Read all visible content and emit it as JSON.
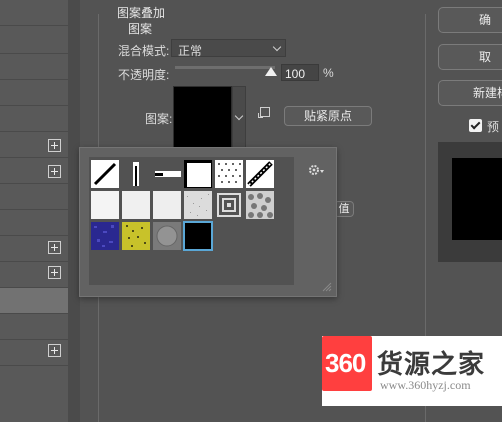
{
  "dialog": {
    "section_title": "图案叠加",
    "group_title": "图案",
    "blend_mode_label": "混合模式:",
    "blend_mode_value": "正常",
    "opacity_label": "不透明度:",
    "opacity_value": "100",
    "opacity_unit": "%",
    "opacity_slider_level": 1.0,
    "pattern_label": "图案:",
    "snap_to_origin_label": "贴紧原点",
    "partial_button_label": "值"
  },
  "right_panel": {
    "confirm_label": "确",
    "cancel_label": "取",
    "new_style_label": "新建样",
    "preview_label": "预",
    "preview_checked": true
  },
  "left_list": {
    "rows": 13,
    "add_buttons": 5,
    "selected_row": 11
  },
  "pattern_picker": {
    "selected_index": 15,
    "patterns": [
      {
        "name": "diagonal-line-1"
      },
      {
        "name": "vertical-line"
      },
      {
        "name": "horizontal-line"
      },
      {
        "name": "white-square-border"
      },
      {
        "name": "dots"
      },
      {
        "name": "diagonal-line-2"
      },
      {
        "name": "light-texture-1"
      },
      {
        "name": "light-texture-2"
      },
      {
        "name": "light-texture-3"
      },
      {
        "name": "noise-texture"
      },
      {
        "name": "concentric-squares"
      },
      {
        "name": "stone-texture"
      },
      {
        "name": "blue-texture"
      },
      {
        "name": "yellow-texture"
      },
      {
        "name": "gray-circle-texture"
      },
      {
        "name": "black-pattern"
      }
    ]
  },
  "watermark": {
    "logo_text": "360",
    "title": "货源之家",
    "url": "www.360hyzj.com"
  },
  "colors": {
    "background": "#535353",
    "selection_accent": "#5aa7d6",
    "watermark_red": "#ff3f3f"
  }
}
